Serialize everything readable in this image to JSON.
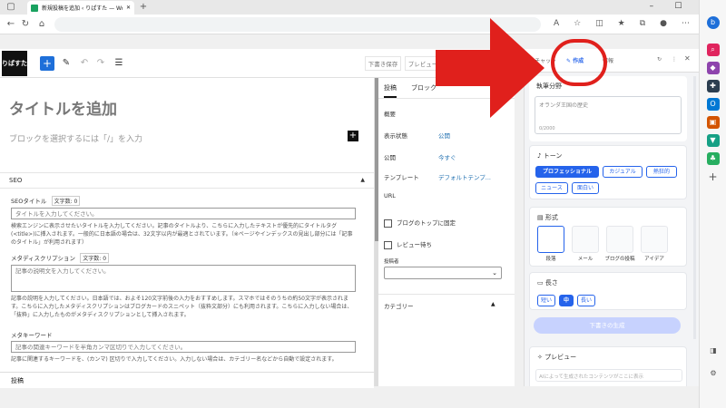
{
  "browser": {
    "tab_title": "新規投稿を追加 ‹ りぱすた — Wo…",
    "new_tab": "+",
    "window_controls": [
      "–",
      "☐",
      "✕"
    ]
  },
  "wp_header": {
    "logo": "りぱすた",
    "draft_label": "下書き保存",
    "preview_label": "プレビュー"
  },
  "editor": {
    "title_placeholder": "タイトルを追加",
    "block_hint": "ブロックを選択するには「/」を入力",
    "seo_section": "SEO",
    "seo_title_label": "SEOタイトル",
    "seo_title_count": "文字数: 0",
    "seo_title_placeholder": "タイトルを入力してください。",
    "seo_title_help": "検索エンジンに表示させたいタイトルを入力してください。記事のタイトルより、こちらに入力したテキストが優先的にタイトルタグ(<title>)に挿入されます。一般的に日本語の場合は、32文字以内が最適とされています。（※ページやインデックスの見出し部分には「記事のタイトル」が利用されます）",
    "meta_desc_label": "メタディスクリプション",
    "meta_desc_count": "文字数: 0",
    "meta_desc_placeholder": "記事の説明文を入力してください。",
    "meta_desc_help": "記事の説明を入力してください。日本語では、およそ120文字前後の入力をおすすめします。スマホではそのうちの約50文字が表示されます。こちらに入力したメタディスクリプションはブログカードのスニペット（抜粋文部分）にも利用されます。こちらに入力しない場合は、「抜粋」に入力したものがメタディスクリプションとして挿入されます。",
    "meta_kw_label": "メタキーワード",
    "meta_kw_placeholder": "記事の関連キーワードを半角カンマ区切りで入力してください。",
    "meta_kw_help": "記事に関連するキーワードを、(カンマ) 区切りで入力してください。入力しない場合は、カテゴリー名などから自動で設定されます。",
    "bottom_label": "投稿"
  },
  "wp_sidebar": {
    "tabs": [
      "投稿",
      "ブロック"
    ],
    "summary": "概要",
    "rows": [
      {
        "label": "表示状態",
        "value": "公開"
      },
      {
        "label": "公開",
        "value": "今すぐ"
      },
      {
        "label": "テンプレート",
        "value": "デフォルトテンプ..."
      },
      {
        "label": "URL",
        "value": ""
      }
    ],
    "sticky_label": "ブログのトップに固定",
    "review_label": "レビュー待ち",
    "author_label": "投稿者",
    "category_label": "カテゴリー"
  },
  "ai_panel": {
    "tabs": [
      "チャット",
      "作成",
      "情報"
    ],
    "field_label": "執筆分野",
    "field_placeholder": "オランダ王国の歴史",
    "field_count": "0/2000",
    "tone_label": "トーン",
    "tones": [
      {
        "label": "プロフェッショナル",
        "active": true
      },
      {
        "label": "カジュアル",
        "active": false
      },
      {
        "label": "熱狂的",
        "active": false
      },
      {
        "label": "ニュース",
        "active": false
      },
      {
        "label": "面白い",
        "active": false
      }
    ],
    "format_label": "形式",
    "formats": [
      {
        "label": "段落",
        "active": true
      },
      {
        "label": "メール",
        "active": false
      },
      {
        "label": "ブログの投稿",
        "active": false
      },
      {
        "label": "アイデア",
        "active": false
      }
    ],
    "length_label": "長さ",
    "lengths": [
      {
        "label": "短い",
        "active": false
      },
      {
        "label": "中",
        "active": true
      },
      {
        "label": "長い",
        "active": false
      }
    ],
    "generate_label": "下書きの生成",
    "preview_label": "プレビュー",
    "preview_hint": "AIによって生成されたコンテンツがここに表示"
  },
  "colors": {
    "accent": "#2563eb",
    "wp_blue": "#1e6fd9",
    "highlight": "#e0201c"
  }
}
